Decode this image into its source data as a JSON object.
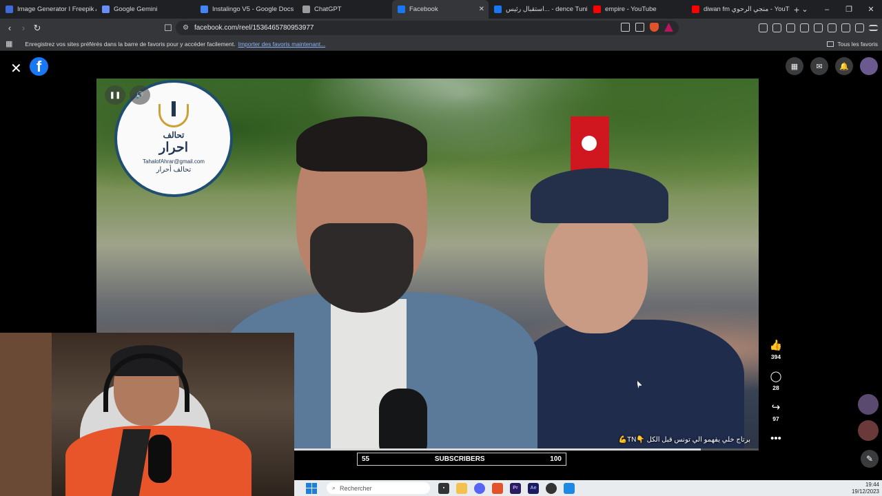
{
  "browser": {
    "tabs": [
      {
        "label": "Image Generator I Freepik AI",
        "icon": "freepik-icon",
        "color": "#3f6ad8"
      },
      {
        "label": "Google Gemini",
        "icon": "gemini-icon",
        "color": "#6a8ef7"
      },
      {
        "label": "Instalingo V5 - Google Docs",
        "icon": "docs-icon",
        "color": "#4285f4"
      },
      {
        "label": "ChatGPT",
        "icon": "chatgpt-icon",
        "color": "#9c9c9c"
      },
      {
        "label": "Facebook",
        "icon": "facebook-icon",
        "color": "#1877f2",
        "active": true
      },
      {
        "label": "استقبال رئيس... - dence Tunisie",
        "icon": "facebook-icon",
        "color": "#1877f2"
      },
      {
        "label": "empire - YouTube",
        "icon": "youtube-icon",
        "color": "#ff0000"
      },
      {
        "label": "diwan fm منجي الرحوي - YouTube",
        "icon": "youtube-icon",
        "color": "#ff0000"
      }
    ],
    "new_tab": "+",
    "url": "facebook.com/reel/1536465780953977",
    "bookmarks_prompt": "Enregistrez vos sites préférés dans la barre de favoris pour y accéder facilement.",
    "bookmarks_link": "Importer des favoris maintenant...",
    "all_bookmarks": "Tous les favoris"
  },
  "facebook": {
    "close_glyph": "✕",
    "logo_letter": "f",
    "video": {
      "badge": {
        "title_small": "تحالف",
        "title_big": "احرار",
        "email": "TahalofAhrar@gmail.com",
        "footer": "تحالف أحرار"
      },
      "caption": "برتاج خلي يفهمو الي تونس قبل الكل 👇TN💪"
    },
    "actions": [
      {
        "icon": "like-icon",
        "glyph": "👍",
        "count": "394"
      },
      {
        "icon": "comment-icon",
        "glyph": "◯",
        "count": "28"
      },
      {
        "icon": "share-icon",
        "glyph": "↪",
        "count": "97"
      },
      {
        "icon": "more-icon",
        "glyph": "•••",
        "count": ""
      }
    ]
  },
  "stream": {
    "progress_fraction": 0.875,
    "subs_current": "55",
    "subs_label": "SUBSCRIBERS",
    "subs_goal": "100"
  },
  "taskbar": {
    "search_placeholder": "Rechercher",
    "time": "19:44",
    "date": "19/12/2023"
  }
}
